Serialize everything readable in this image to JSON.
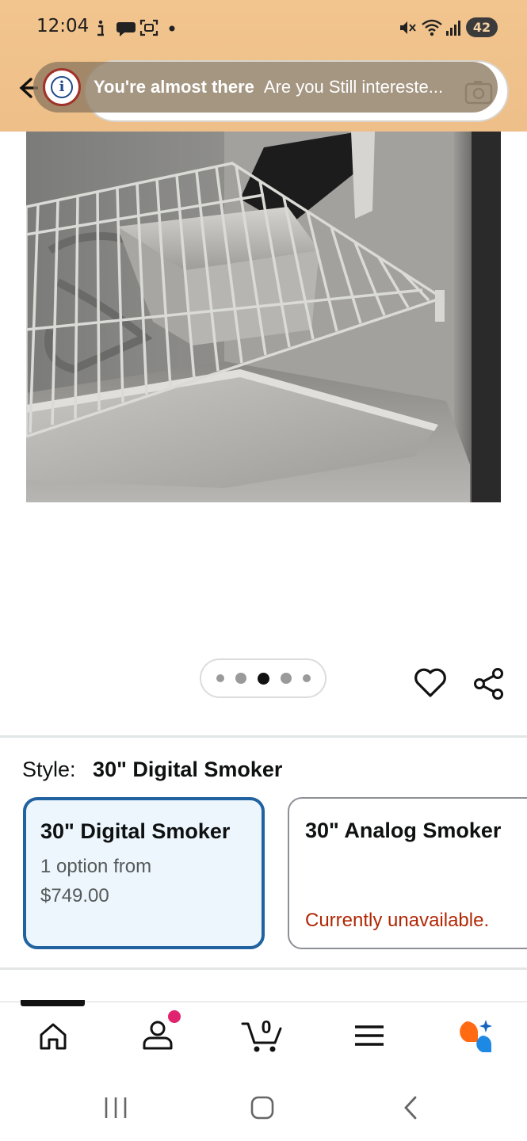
{
  "status_bar": {
    "time": "12:04",
    "battery": "42",
    "icons": [
      "info-icon",
      "chat-icon",
      "screenshot-icon",
      "dot-icon",
      "mute-icon",
      "wifi-icon",
      "signal-icon",
      "battery-icon"
    ]
  },
  "header": {
    "toast": {
      "title": "You're almost there",
      "message": "Are you Still intereste..."
    },
    "icons": [
      "back-arrow-icon",
      "info-icon",
      "camera-icon"
    ]
  },
  "gallery": {
    "image_alt": "Stainless steel smoker interior with wire rack, water pan and drip tray",
    "total_images": 5,
    "active_index": 3
  },
  "style": {
    "label": "Style:",
    "selected_value": "30\" Digital Smoker",
    "options": [
      {
        "title": "30\" Digital Smoker",
        "line1": "1 option from",
        "price": "$749.00",
        "selected": true
      },
      {
        "title": "30\" Analog Smoker",
        "status": "Currently unavailable.",
        "selected": false
      }
    ]
  },
  "bottom_nav": {
    "cart_count": "0",
    "items": [
      "home-icon",
      "account-icon",
      "cart-icon",
      "menu-icon",
      "rufus-icon"
    ]
  },
  "colors": {
    "header_bg": "#f2c48e",
    "selected_border": "#2162a1",
    "selected_bg": "#edf6fd",
    "unavailable": "#b12704",
    "notification_dot": "#e0246f"
  }
}
